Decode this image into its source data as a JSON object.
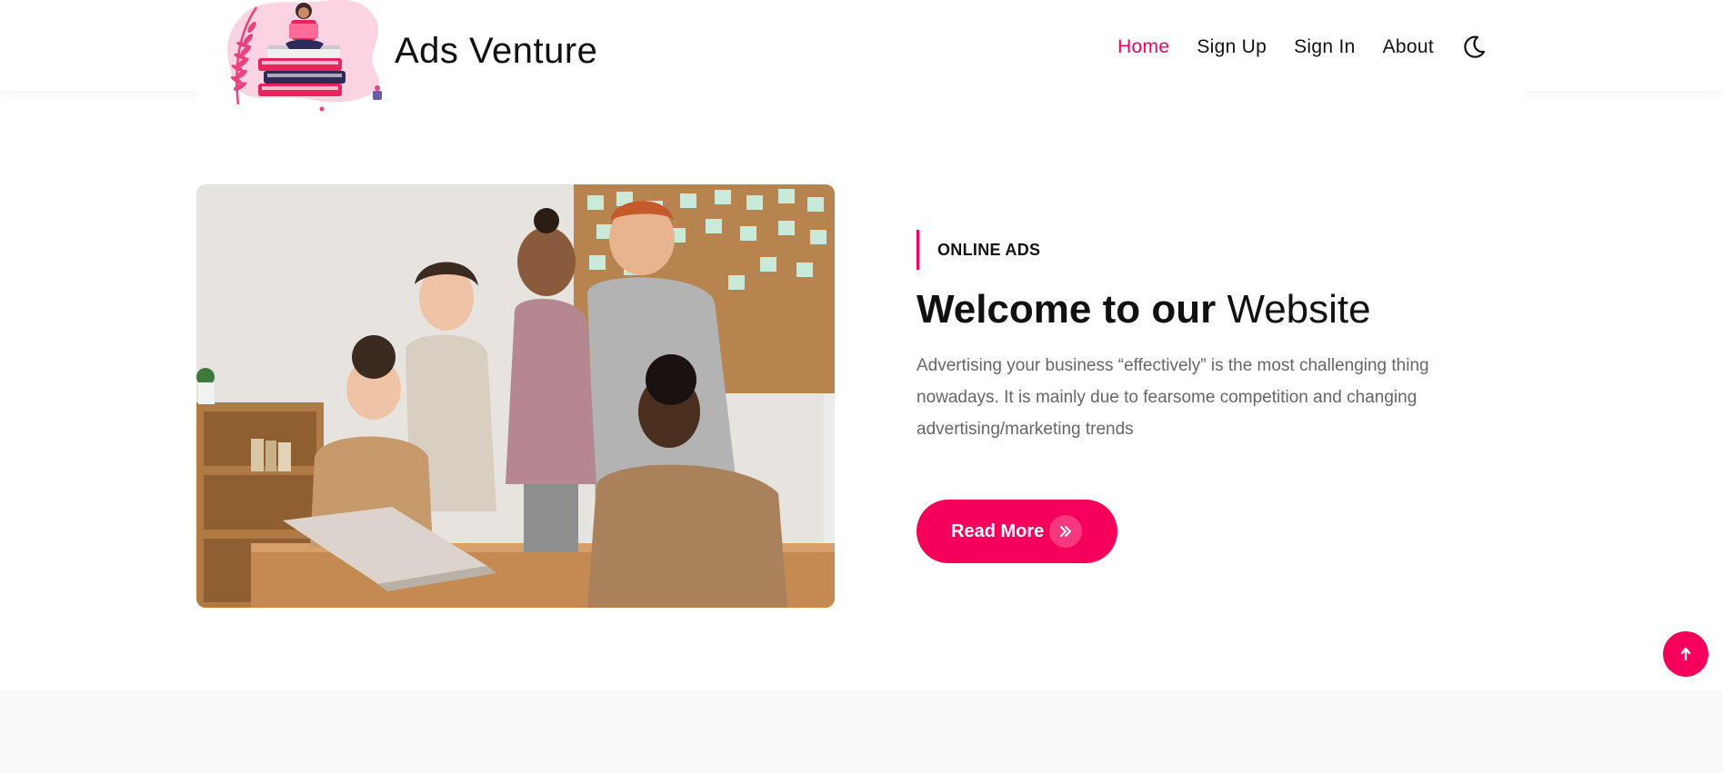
{
  "header": {
    "brand": "Ads Venture",
    "nav": [
      {
        "label": "Home",
        "active": true
      },
      {
        "label": "Sign Up",
        "active": false
      },
      {
        "label": "Sign In",
        "active": false
      },
      {
        "label": "About",
        "active": false
      }
    ],
    "theme_icon": "moon-icon"
  },
  "hero": {
    "eyebrow": "ONLINE ADS",
    "title_bold": "Welcome to our",
    "title_light": "Website",
    "description": "Advertising your business “effectively” is the most challenging thing nowadays. It is mainly due to fearsome competition and changing advertising/marketing trends",
    "cta_label": "Read More",
    "cta_icon": "double-chevron-right-icon"
  },
  "scroll_top_icon": "arrow-up-icon",
  "colors": {
    "accent": "#f5005a",
    "text": "#111111",
    "muted": "#666666",
    "section_bg": "#f9f9f9"
  }
}
